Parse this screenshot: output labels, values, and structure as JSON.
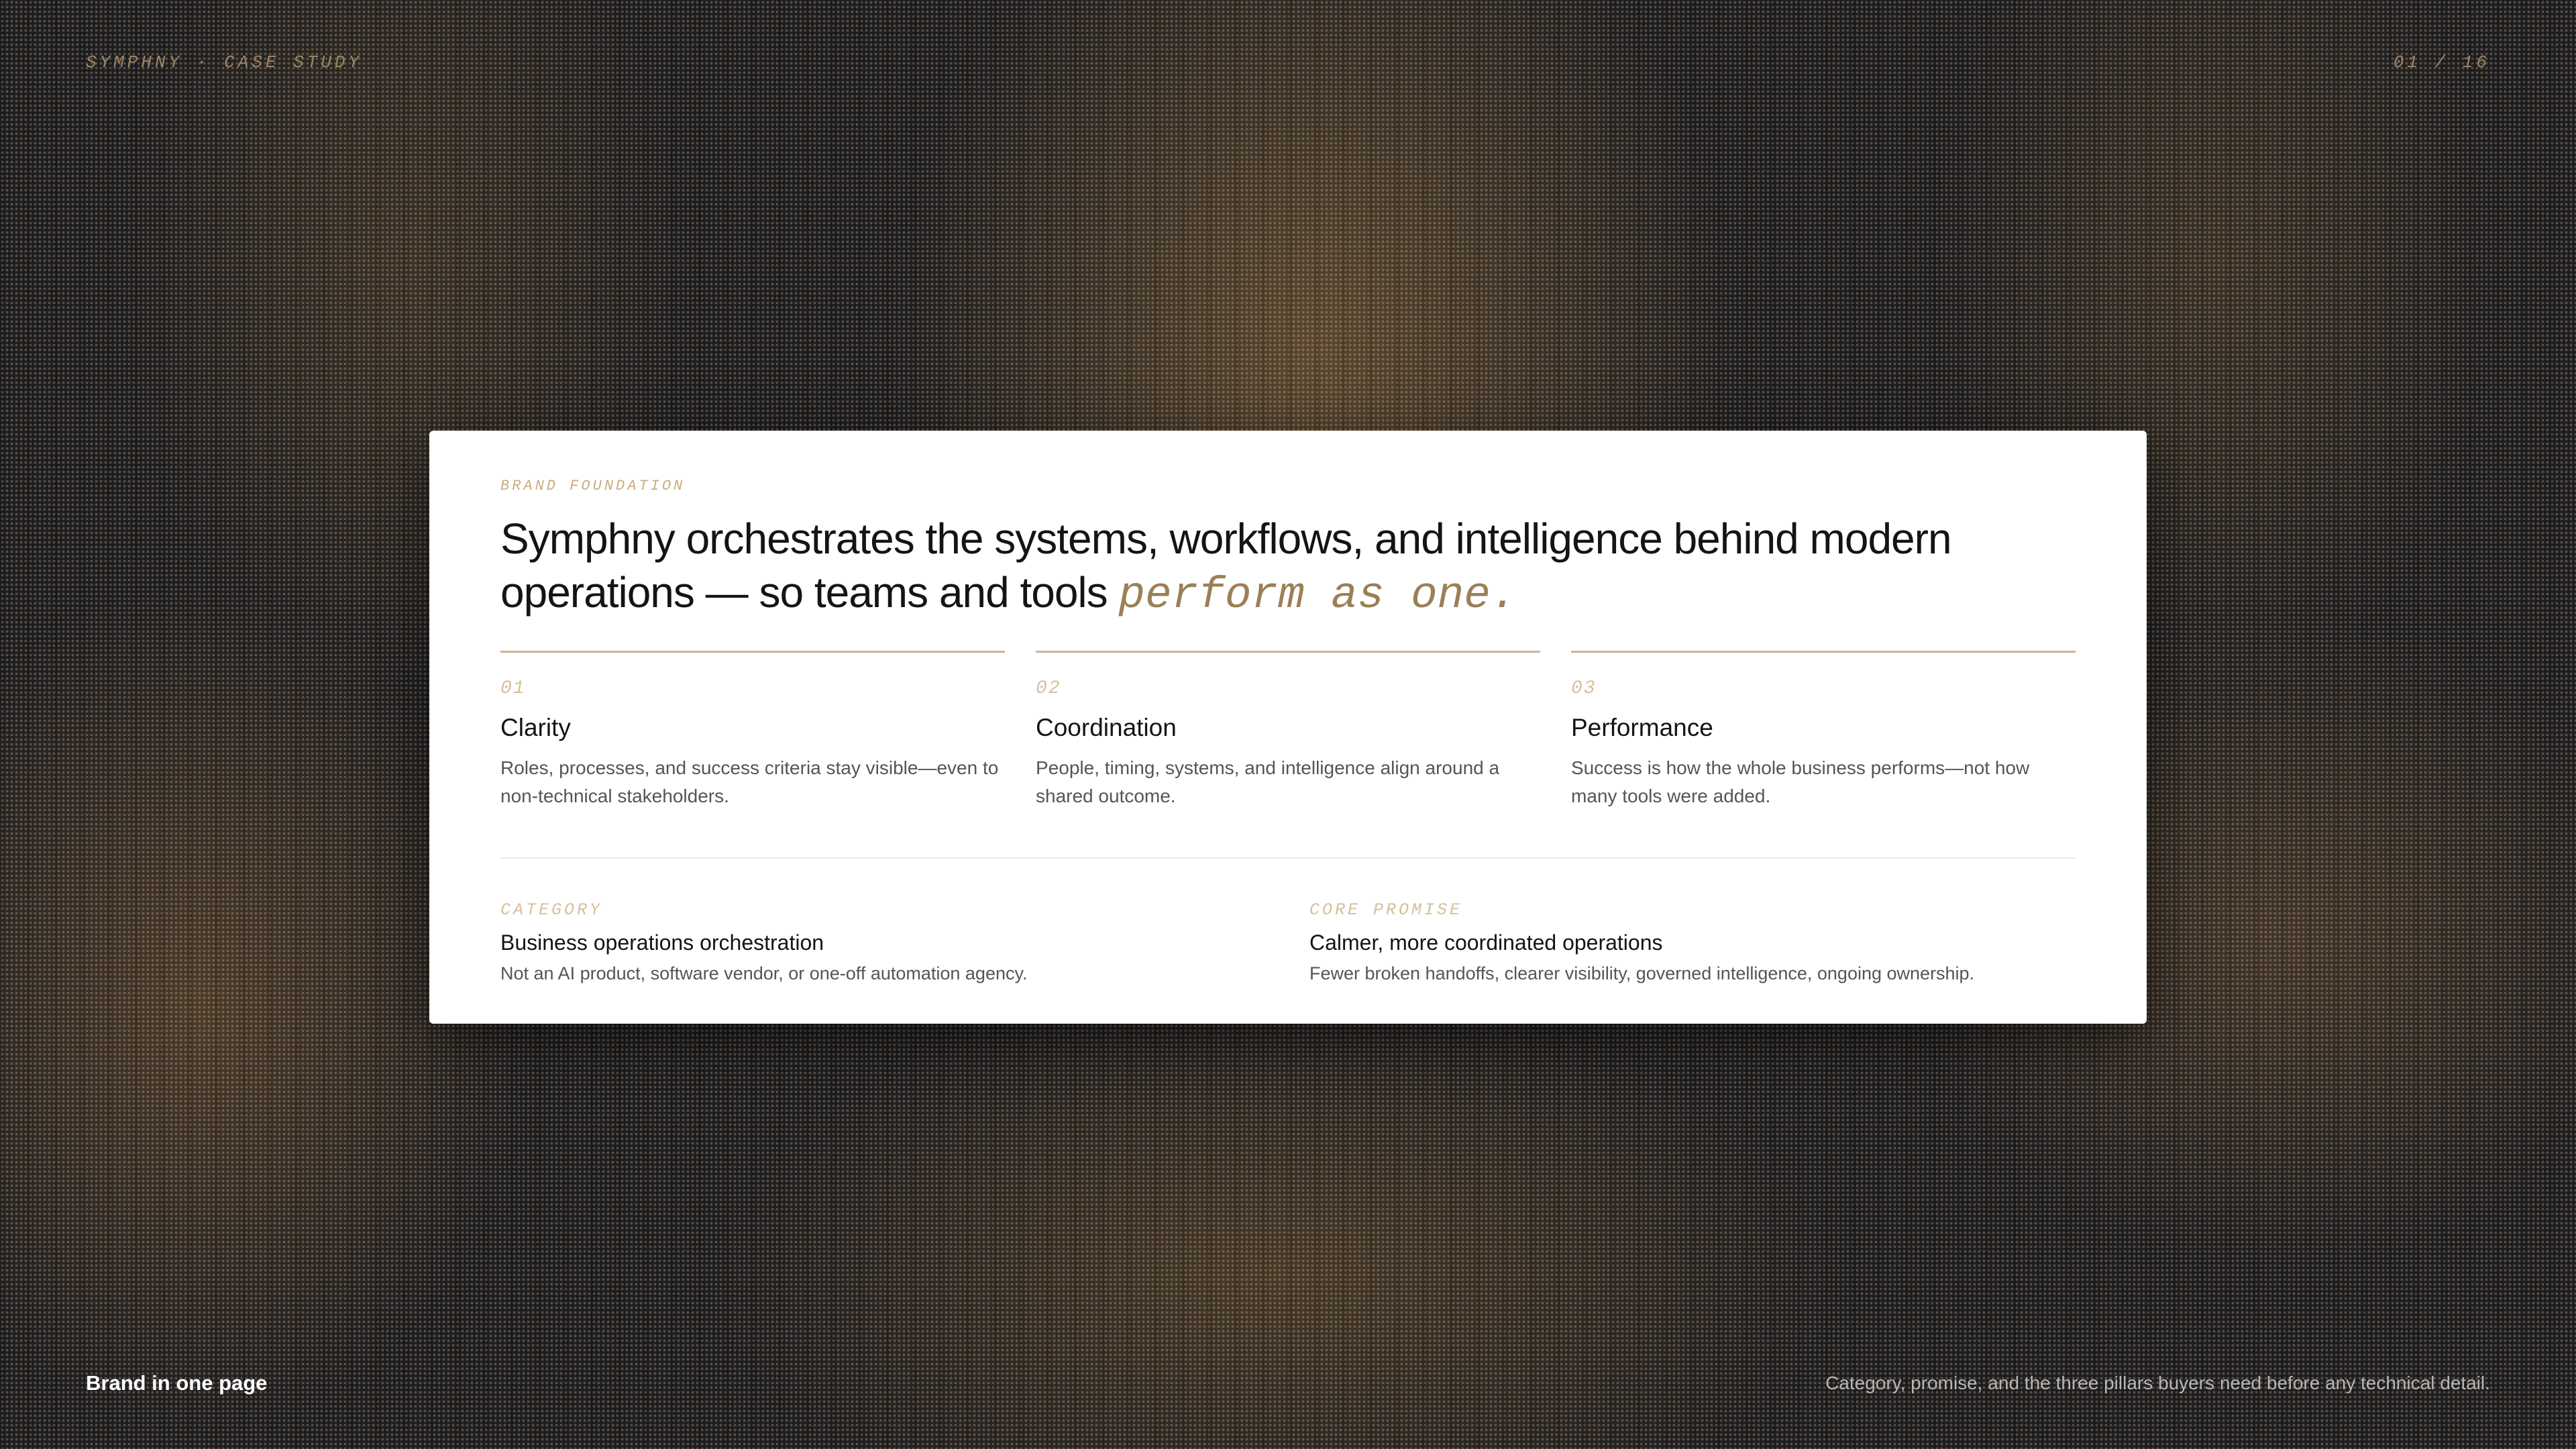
{
  "header": {
    "brand_line": "SYMPHNY · CASE STUDY",
    "page_counter": "01 / 16"
  },
  "card": {
    "eyebrow": "BRAND FOUNDATION",
    "headline_main": "Symphny orchestrates the systems, workflows, and intelligence behind modern operations — so teams and tools ",
    "headline_accent": "perform as one.",
    "pillars": [
      {
        "number": "01",
        "title": "Clarity",
        "body": "Roles, processes, and success criteria stay visible—even to non-technical stakeholders."
      },
      {
        "number": "02",
        "title": "Coordination",
        "body": "People, timing, systems, and intelligence align around a shared outcome."
      },
      {
        "number": "03",
        "title": "Performance",
        "body": "Success is how the whole business performs—not how many tools were added."
      }
    ],
    "facts": [
      {
        "label": "CATEGORY",
        "title": "Business operations orchestration",
        "body": "Not an AI product, software vendor, or one-off automation agency."
      },
      {
        "label": "CORE PROMISE",
        "title": "Calmer, more coordinated operations",
        "body": "Fewer broken handoffs, clearer visibility, governed intelligence, ongoing ownership."
      }
    ]
  },
  "footer": {
    "section_title": "Brand in one page",
    "caption": "Category, promise, and the three pillars buyers need before any technical detail."
  },
  "colors": {
    "accent_gold": "#cfb58d",
    "accent_text": "#9b7f56",
    "background": "#1c1d22"
  }
}
